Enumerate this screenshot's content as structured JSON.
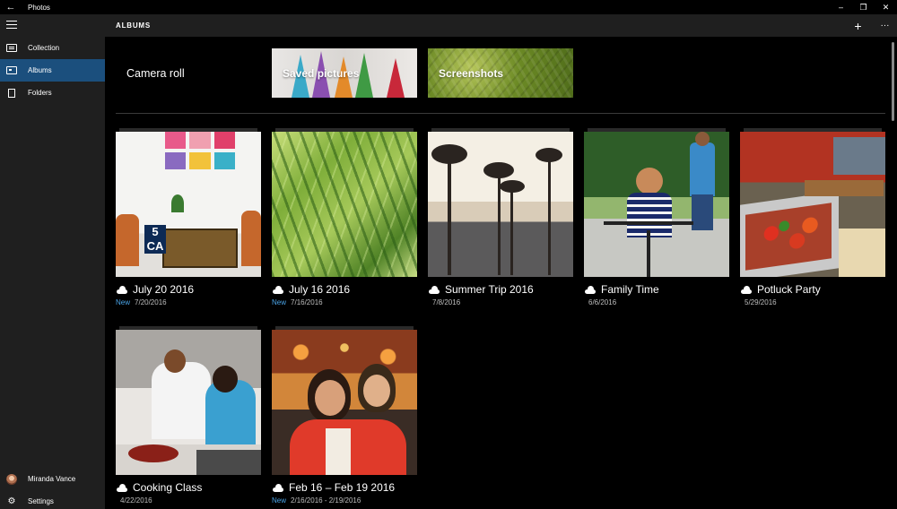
{
  "titlebar": {
    "title": "Photos",
    "back_icon": "arrow-left-icon",
    "controls": [
      "minimize",
      "restore",
      "close"
    ]
  },
  "sidebar": {
    "items": [
      {
        "label": "Collection",
        "icon": "collection-icon"
      },
      {
        "label": "Albums",
        "icon": "album-icon",
        "active": true
      },
      {
        "label": "Folders",
        "icon": "folder-icon"
      }
    ],
    "user": {
      "name": "Miranda Vance"
    },
    "settings": {
      "label": "Settings"
    }
  },
  "header": {
    "title": "ALBUMS",
    "add_label": "+",
    "more_label": "···"
  },
  "special_albums": [
    {
      "label": "Camera roll"
    },
    {
      "label": "Saved pictures"
    },
    {
      "label": "Screenshots"
    }
  ],
  "albums": [
    {
      "name": "July 20 2016",
      "new": "New",
      "date": "7/20/2016"
    },
    {
      "name": "July 16 2016",
      "new": "New",
      "date": "7/16/2016"
    },
    {
      "name": "Summer Trip 2016",
      "new": "",
      "date": "7/8/2016"
    },
    {
      "name": "Family Time",
      "new": "",
      "date": "6/6/2016"
    },
    {
      "name": "Potluck Party",
      "new": "",
      "date": "5/29/2016"
    },
    {
      "name": "Cooking Class",
      "new": "",
      "date": "4/22/2016"
    },
    {
      "name": "Feb 16 – Feb 19 2016",
      "new": "New",
      "date": "2/16/2016 - 2/19/2016"
    }
  ],
  "colors": {
    "sidebar_bg": "#1f1f1f",
    "active_item": "#1b4f7d",
    "new_badge": "#4aa3e6"
  }
}
